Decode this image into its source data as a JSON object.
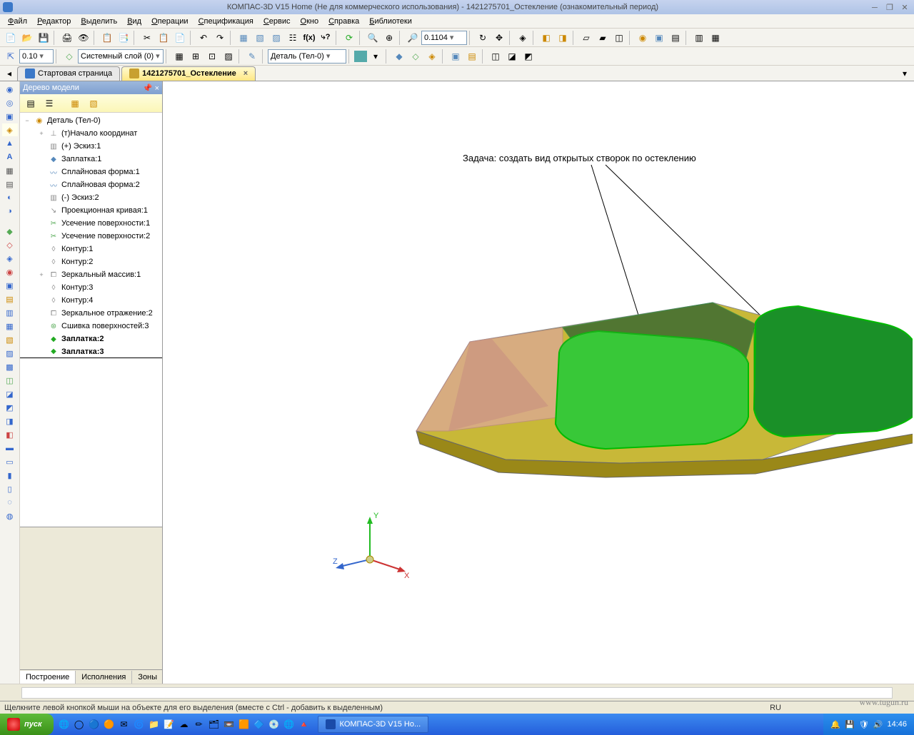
{
  "titlebar": {
    "title": "КОМПАС-3D V15 Home (Не для коммерческого использования) - 1421275701_Остекление (ознакомительный период)"
  },
  "menubar": [
    "Файл",
    "Редактор",
    "Выделить",
    "Вид",
    "Операции",
    "Спецификация",
    "Сервис",
    "Окно",
    "Справка",
    "Библиотеки"
  ],
  "toolbar1_combo": "0.1104",
  "toolbar2": {
    "step": "0.10",
    "layer": "Системный слой (0)",
    "part": "Деталь (Тел-0)"
  },
  "tabs": [
    {
      "label": "Стартовая страница",
      "active": false
    },
    {
      "label": "1421275701_Остекление",
      "active": true
    }
  ],
  "tree": {
    "title": "Дерево модели",
    "root": "Деталь (Тел-0)",
    "items": [
      {
        "exp": "+",
        "icon": "axis",
        "label": "(т)Начало координат",
        "indent": 1
      },
      {
        "exp": "",
        "icon": "sketch",
        "label": "(+) Эскиз:1",
        "indent": 1
      },
      {
        "exp": "",
        "icon": "patch",
        "label": "Заплатка:1",
        "indent": 1
      },
      {
        "exp": "",
        "icon": "spline",
        "label": "Сплайновая форма:1",
        "indent": 1
      },
      {
        "exp": "",
        "icon": "spline",
        "label": "Сплайновая форма:2",
        "indent": 1
      },
      {
        "exp": "",
        "icon": "sketch",
        "label": "(-) Эскиз:2",
        "indent": 1
      },
      {
        "exp": "",
        "icon": "proj",
        "label": "Проекционная кривая:1",
        "indent": 1
      },
      {
        "exp": "",
        "icon": "trim",
        "label": "Усечение поверхности:1",
        "indent": 1
      },
      {
        "exp": "",
        "icon": "trim",
        "label": "Усечение поверхности:2",
        "indent": 1
      },
      {
        "exp": "",
        "icon": "contour",
        "label": "Контур:1",
        "indent": 1
      },
      {
        "exp": "",
        "icon": "contour",
        "label": "Контур:2",
        "indent": 1
      },
      {
        "exp": "+",
        "icon": "mirror",
        "label": "Зеркальный массив:1",
        "indent": 1
      },
      {
        "exp": "",
        "icon": "contour",
        "label": "Контур:3",
        "indent": 1
      },
      {
        "exp": "",
        "icon": "contour",
        "label": "Контур:4",
        "indent": 1
      },
      {
        "exp": "",
        "icon": "mirror",
        "label": "Зеркальное отражение:2",
        "indent": 1
      },
      {
        "exp": "",
        "icon": "sew",
        "label": "Сшивка поверхностей:3",
        "indent": 1
      },
      {
        "exp": "",
        "icon": "patchg",
        "label": "Заплатка:2",
        "indent": 1,
        "bold": true
      },
      {
        "exp": "",
        "icon": "patchg",
        "label": "Заплатка:3",
        "indent": 1,
        "bold": true,
        "underline": true
      }
    ],
    "tabs": [
      "Построение",
      "Исполнения",
      "Зоны"
    ]
  },
  "viewport": {
    "annotation": "Задача: создать вид открытых створок по остеклению",
    "axes": {
      "x": "X",
      "y": "Y",
      "z": "Z"
    }
  },
  "status": {
    "hint": "Щелкните левой кнопкой мыши на объекте для его выделения (вместе с Ctrl - добавить к выделенным)",
    "lang": "RU"
  },
  "taskbar": {
    "start": "пуск",
    "task": "КОМПАС-3D V15 Ho...",
    "time": "14:46"
  },
  "watermark": "www.tugun.ru"
}
